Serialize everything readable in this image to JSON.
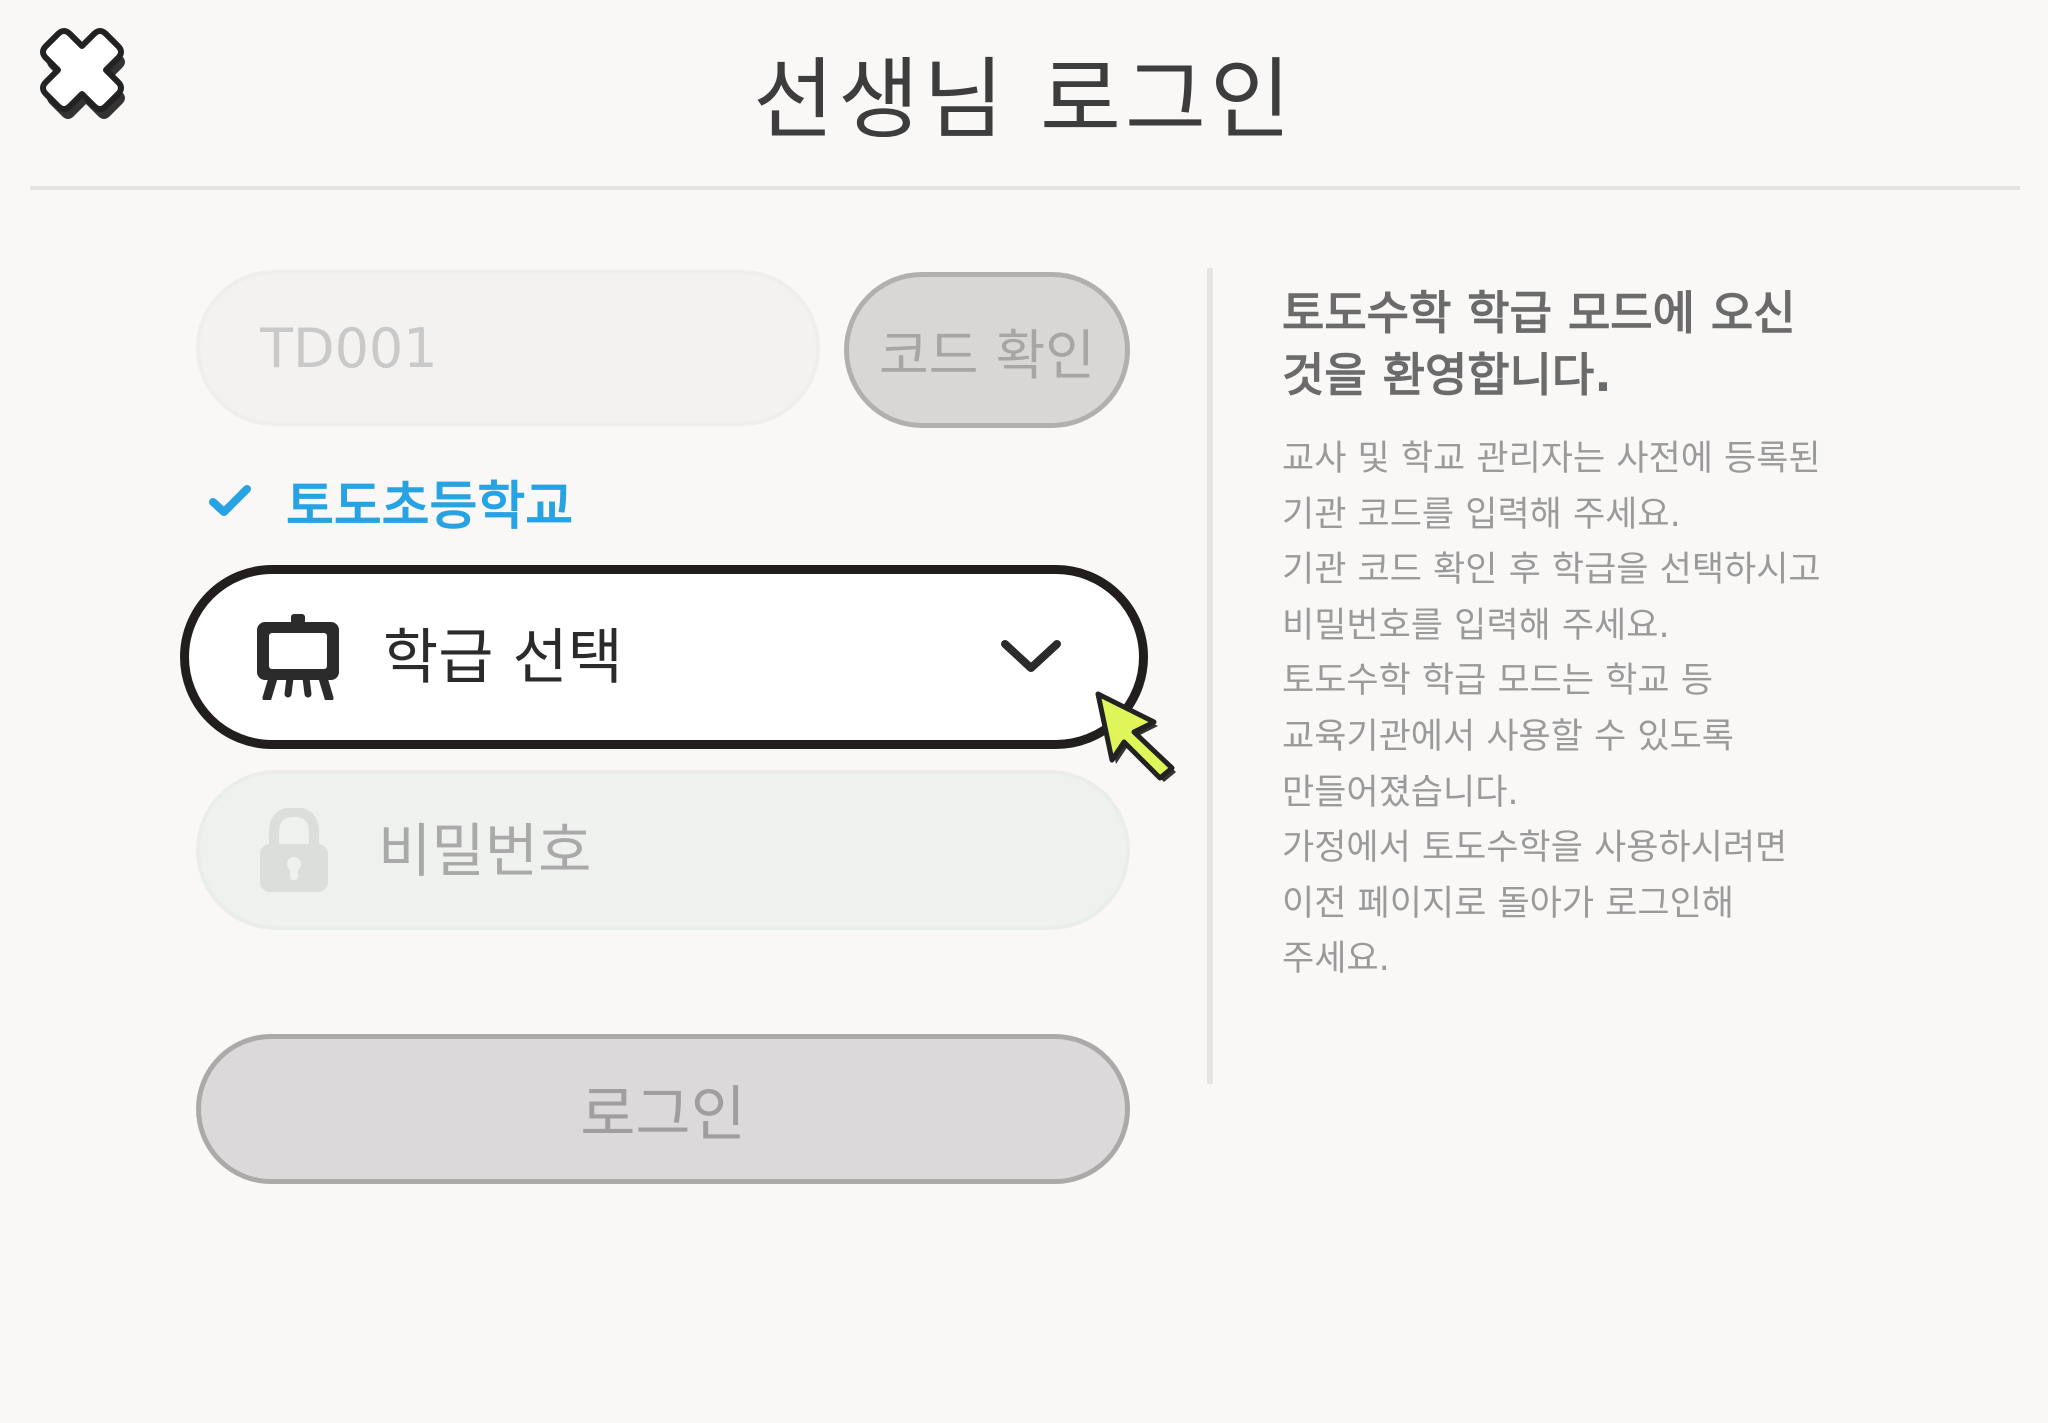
{
  "header": {
    "title": "선생님 로그인",
    "close_icon": "close-x-icon"
  },
  "form": {
    "code_input": {
      "placeholder": "TD001",
      "value": ""
    },
    "code_confirm_label": "코드 확인",
    "selected_school": "토도초등학교",
    "class_select": {
      "label": "학급 선택",
      "icon": "easel-board-icon"
    },
    "password_input": {
      "placeholder": "비밀번호",
      "icon": "lock-icon"
    },
    "login_label": "로그인"
  },
  "info": {
    "title": "토도수학 학급 모드에 오신 것을 환영합니다.",
    "lines": [
      "교사 및 학교 관리자는 사전에 등록된",
      "기관 코드를 입력해 주세요.",
      "기관 코드 확인 후 학급을 선택하시고",
      "비밀번호를 입력해 주세요.",
      "토도수학 학급 모드는 학교 등",
      "교육기관에서 사용할 수 있도록",
      "만들어졌습니다.",
      "가정에서 토도수학을 사용하시려면",
      "이전 페이지로 돌아가 로그인해",
      "주세요."
    ]
  },
  "colors": {
    "accent_blue": "#27a3e3",
    "pointer_yellow": "#dff55a",
    "outline_dark": "#221e1e",
    "background": "#f9f8f7"
  }
}
